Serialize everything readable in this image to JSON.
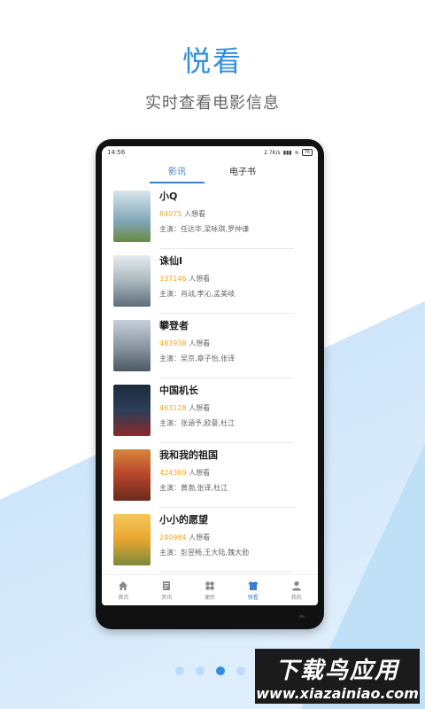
{
  "hero": {
    "title": "悦看",
    "subtitle": "实时查看电影信息"
  },
  "status_bar": {
    "time": "14:56",
    "speed": "2.7K/s",
    "battery": "76"
  },
  "tabs": [
    {
      "label": "影讯",
      "active": true
    },
    {
      "label": "电子书",
      "active": false
    }
  ],
  "movies": [
    {
      "title": "小Q",
      "count": "84075",
      "want_label": "人想看",
      "cast": "主演：任达华,梁咏琪,罗仲谦",
      "poster_color": "#7fa6b8"
    },
    {
      "title": "诛仙Ⅰ",
      "count": "337146",
      "want_label": "人想看",
      "cast": "主演：肖战,李沁,孟美岐",
      "poster_color": "#a9b7bd"
    },
    {
      "title": "攀登者",
      "count": "483938",
      "want_label": "人想看",
      "cast": "主演：吴京,章子怡,张译",
      "poster_color": "#8c99a6"
    },
    {
      "title": "中国机长",
      "count": "463128",
      "want_label": "人想看",
      "cast": "主演：张涵予,欧豪,杜江",
      "poster_color": "#2c3e58"
    },
    {
      "title": "我和我的祖国",
      "count": "424369",
      "want_label": "人想看",
      "cast": "主演：黄渤,张译,杜江",
      "poster_color": "#b5442c"
    },
    {
      "title": "小小的愿望",
      "count": "240984",
      "want_label": "人想看",
      "cast": "主演：彭昱畅,王大陆,魏大勋",
      "poster_color": "#e8a530"
    }
  ],
  "bottom_nav": [
    {
      "label": "首页",
      "icon": "home-icon",
      "active": false
    },
    {
      "label": "资讯",
      "icon": "news-icon",
      "active": false
    },
    {
      "label": "便民",
      "icon": "grid-icon",
      "active": false
    },
    {
      "label": "悦看",
      "icon": "shirt-icon",
      "active": true
    },
    {
      "label": "我的",
      "icon": "person-icon",
      "active": false
    }
  ],
  "pager": {
    "count": 4,
    "active_index": 2
  },
  "watermark": {
    "top": "下载鸟应用",
    "bottom": "www.xiazainiao.com"
  },
  "colors": {
    "accent": "#2f8ee0",
    "count": "#f2a524"
  }
}
